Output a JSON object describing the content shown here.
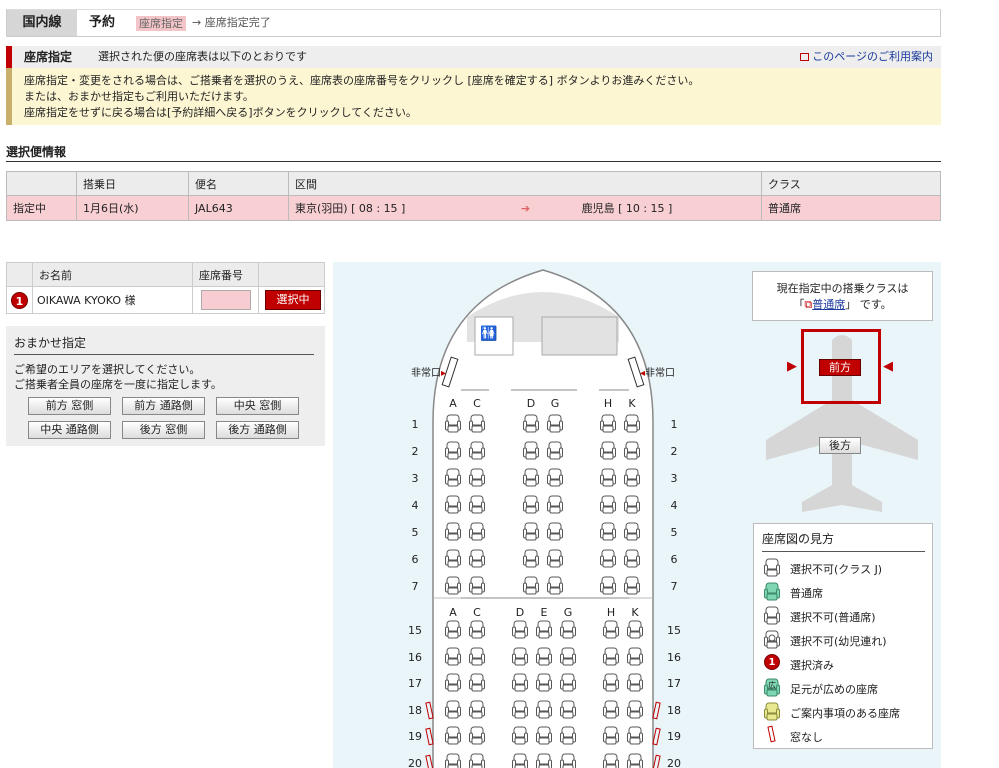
{
  "breadcrumb": {
    "domestic": "国内線",
    "reserve": "予約",
    "current": "座席指定",
    "next": "→ 座席指定完了"
  },
  "info": {
    "title": "座席指定",
    "subtitle": "選択された便の座席表は以下のとおりです",
    "help_link": "このページのご利用案内",
    "lines": [
      "座席指定・変更をされる場合は、ご搭乗者を選択のうえ、座席表の座席番号をクリックし [座席を確定する] ボタンよりお進みください。",
      "または、おまかせ指定もご利用いただけます。",
      "座席指定をせずに戻る場合は[予約詳細へ戻る]ボタンをクリックしてください。"
    ]
  },
  "selected_flight": {
    "heading": "選択便情報",
    "headers": {
      "date": "搭乗日",
      "flight": "便名",
      "route": "区間",
      "class": "クラス"
    },
    "row": {
      "status": "指定中",
      "date": "1月6日(水)",
      "flight": "JAL643",
      "from": "東京(羽田) [ 08 : 15 ]",
      "to": "鹿児島 [ 10 : 15 ]",
      "class": "普通席"
    }
  },
  "passengers": {
    "headers": {
      "name": "お名前",
      "seat": "座席番号"
    },
    "rows": [
      {
        "no": "1",
        "name": "OIKAWA KYOKO 様",
        "seat": "",
        "button": "選択中"
      }
    ]
  },
  "omakase": {
    "title": "おまかせ指定",
    "line1": "ご希望のエリアを選択してください。",
    "line2": "ご搭乗者全員の座席を一度に指定します。",
    "buttons": [
      "前方 窓側",
      "前方 通路側",
      "中央 窓側",
      "中央 通路側",
      "後方 窓側",
      "後方 通路側"
    ]
  },
  "seatmap": {
    "exit_label": "非常口",
    "front_cols": [
      "A",
      "C",
      "D",
      "G",
      "H",
      "K"
    ],
    "rear_cols": [
      "A",
      "C",
      "D",
      "E",
      "G",
      "H",
      "K"
    ],
    "front_rows": [
      "1",
      "2",
      "3",
      "4",
      "5",
      "6",
      "7"
    ],
    "rear_rows": [
      "15",
      "16",
      "17",
      "18",
      "19",
      "20"
    ]
  },
  "class_panel": {
    "line1": "現在指定中の搭乗クラスは",
    "open_q": "「",
    "class_link": "普通席",
    "close_q": "」 です。",
    "front_btn": "前方",
    "rear_btn": "後方"
  },
  "legend": {
    "title": "座席図の見方",
    "items": [
      {
        "icon": "seat-outline-icon",
        "label": "選択不可(クラス J)"
      },
      {
        "icon": "seat-green-icon",
        "label": "普通席"
      },
      {
        "icon": "seat-outline-icon",
        "label": "選択不可(普通席)"
      },
      {
        "icon": "seat-infant-icon",
        "label": "選択不可(幼児連れ)"
      },
      {
        "icon": "selected-badge-icon",
        "label": "選択済み"
      },
      {
        "icon": "seat-legroom-icon",
        "label": "足元が広めの座席",
        "icon_text": "広"
      },
      {
        "icon": "seat-yellow-icon",
        "label": "ご案内事項のある座席"
      },
      {
        "icon": "no-window-icon",
        "label": "窓なし"
      }
    ]
  },
  "colors": {
    "accent": "#c00000",
    "selected_row": "#f8d0d4",
    "notice_bg": "#fdf6d3",
    "link": "#1a3a9c",
    "map_bg": "#eaf5fa"
  }
}
